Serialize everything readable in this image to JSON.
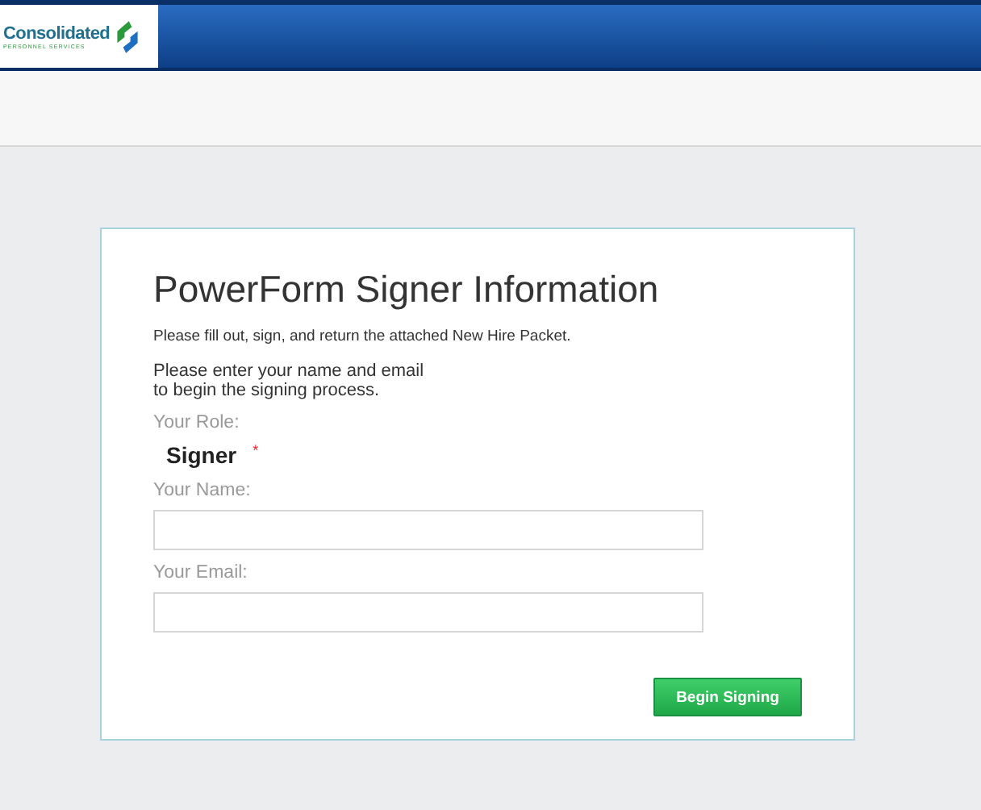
{
  "header": {
    "logo_name": "Consolidated",
    "logo_tagline": "PERSONNEL SERVICES"
  },
  "form": {
    "title": "PowerForm Signer Information",
    "instructions": "Please fill out, sign, and return the attached New Hire Packet.",
    "prompt_lines": [
      "Please enter your name and email",
      "to begin the signing process."
    ],
    "role": {
      "label": "Your Role:",
      "value": "Signer",
      "required_mark": "*"
    },
    "fields": [
      {
        "label": "Your Name:"
      },
      {
        "label": "Your Email:"
      }
    ],
    "submit": "Begin Signing"
  }
}
